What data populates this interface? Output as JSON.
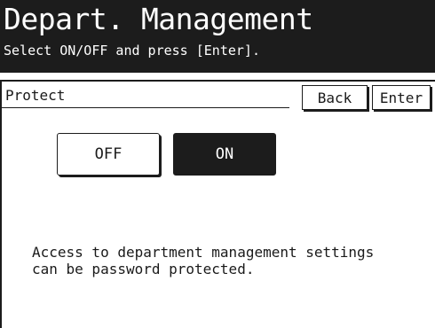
{
  "header": {
    "title": "Depart. Management",
    "subtitle": "Select ON/OFF and press [Enter]."
  },
  "section": {
    "label": "Protect"
  },
  "buttons": {
    "back": "Back",
    "enter": "Enter"
  },
  "toggle": {
    "off_label": "OFF",
    "on_label": "ON",
    "selected": "ON"
  },
  "description": {
    "line1": "Access to department management settings",
    "line2": "can be password protected."
  },
  "colors": {
    "header_bg": "#1c1c1c",
    "selected_bg": "#1c1c1c",
    "page_bg": "#ffffff"
  }
}
